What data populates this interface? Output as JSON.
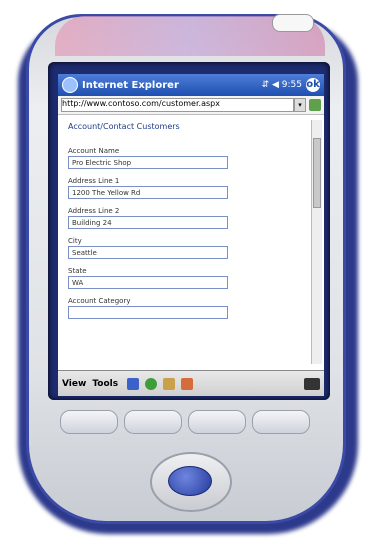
{
  "window": {
    "title": "Internet Explorer",
    "close_label": "ok",
    "status_icons": "⇵ ◀ 9:55"
  },
  "address_bar": {
    "value": "http://www.contoso.com/customer.aspx"
  },
  "form": {
    "section_title": "Account/Contact Customers",
    "fields": [
      {
        "label": "Account Name",
        "value": "Pro Electric Shop"
      },
      {
        "label": "Address Line 1",
        "value": "1200 The Yellow Rd"
      },
      {
        "label": "Address Line 2",
        "value": "Building 24"
      },
      {
        "label": "City",
        "value": "Seattle"
      },
      {
        "label": "State",
        "value": "WA"
      },
      {
        "label": "Account Category",
        "value": ""
      }
    ]
  },
  "menu": {
    "view": "View",
    "tools": "Tools"
  },
  "colors": {
    "device_trim": "#3b4aa6",
    "titlebar": "#1f4fb0",
    "nav_center": "#243a9c"
  }
}
